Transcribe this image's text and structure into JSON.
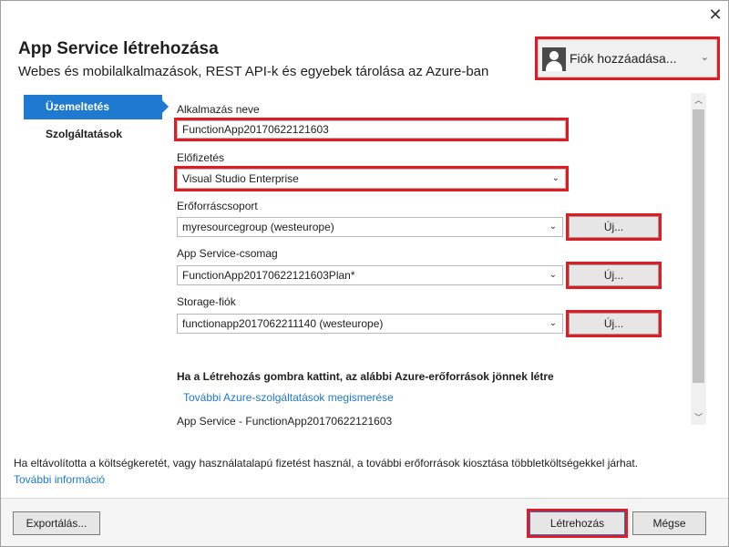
{
  "dialog": {
    "close_glyph": "✕",
    "title": "App Service létrehozása",
    "subtitle": "Webes és mobilalkalmazások, REST API-k és egyebek tárolása az Azure-ban"
  },
  "account": {
    "label": "Fiók hozzáadása...",
    "icon": "user-icon"
  },
  "nav": {
    "items": [
      {
        "label": "Üzemeltetés"
      },
      {
        "label": "Szolgáltatások"
      }
    ]
  },
  "form": {
    "app_name": {
      "label": "Alkalmazás neve",
      "value": "FunctionApp20170622121603"
    },
    "subscription": {
      "label": "Előfizetés",
      "value": "Visual Studio Enterprise"
    },
    "resource_group": {
      "label": "Erőforráscsoport",
      "value": "myresourcegroup (westeurope)",
      "new_label": "Új..."
    },
    "plan": {
      "label": "App Service-csomag",
      "value": "FunctionApp20170622121603Plan*",
      "new_label": "Új..."
    },
    "storage": {
      "label": "Storage-fiók",
      "value": "functionapp2017062211140 (westeurope)",
      "new_label": "Új..."
    }
  },
  "info": {
    "heading": "Ha a Létrehozás gombra kattint, az alábbi Azure-erőforrások jönnek létre",
    "link": "További Azure-szolgáltatások megismerése",
    "resource": "App Service - FunctionApp20170622121603"
  },
  "footer": {
    "notice": "Ha eltávolította a költségkeretét, vagy használatalapú fizetést használ, a további erőforrások kiosztása többletköltségekkel járhat.",
    "more_link": "További információ"
  },
  "buttons": {
    "export": "Exportálás...",
    "create": "Létrehozás",
    "cancel": "Mégse"
  },
  "colors": {
    "accent": "#1e79d0",
    "highlight": "#e21b23"
  }
}
